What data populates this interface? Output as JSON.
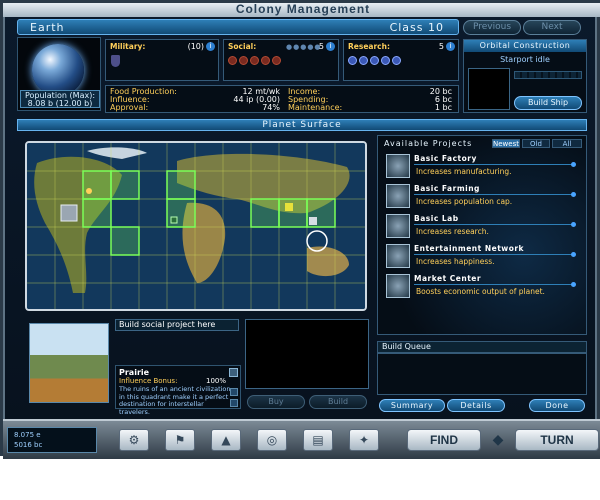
{
  "window": {
    "title": "Colony Management"
  },
  "planet": {
    "name": "Earth",
    "class": "Class 10",
    "population": "Population (Max):",
    "population_value": "8.08 b (12.00 b)",
    "prev_label": "Previous",
    "next_label": "Next"
  },
  "stats": {
    "military": {
      "label": "Military:",
      "value": "(10)"
    },
    "social": {
      "label": "Social:",
      "value": "5"
    },
    "research": {
      "label": "Research:",
      "value": "5"
    }
  },
  "economy": {
    "food_label": "Food Production:",
    "food_value": "12 mt/wk",
    "influence_label": "Influence:",
    "influence_value": "44 ip (0.00)",
    "approval_label": "Approval:",
    "approval_value": "74%",
    "income_label": "Income:",
    "income_value": "20 bc",
    "spending_label": "Spending:",
    "spending_value": "6 bc",
    "maintenance_label": "Maintenance:",
    "maintenance_value": "1 bc"
  },
  "orbital": {
    "title": "Orbital Construction",
    "status": "Starport idle",
    "build_ship_label": "Build Ship"
  },
  "surface": {
    "title": "Planet Surface",
    "build_label": "Build social project here",
    "tile_name": "Prairie",
    "bonus_label": "Influence Bonus:",
    "bonus_value": "100%",
    "description": "The ruins of an ancient civilization in this quadrant make it a perfect destination for interstellar travelers.",
    "buy_label": "Buy",
    "build_btn_label": "Build"
  },
  "projects": {
    "title": "Available Projects",
    "tabs": [
      "Newest",
      "Old",
      "All"
    ],
    "items": [
      {
        "name": "Basic Factory",
        "desc": "Increases manufacturing.",
        "icon": "factory-icon"
      },
      {
        "name": "Basic Farming",
        "desc": "Increases population cap.",
        "icon": "farm-icon"
      },
      {
        "name": "Basic Lab",
        "desc": "Increases research.",
        "icon": "lab-icon"
      },
      {
        "name": "Entertainment Network",
        "desc": "Increases happiness.",
        "icon": "entertainment-icon"
      },
      {
        "name": "Market Center",
        "desc": "Boosts economic output of planet.",
        "icon": "market-icon"
      }
    ]
  },
  "queue": {
    "title": "Build Queue",
    "summary_label": "Summary",
    "details_label": "Details",
    "done_label": "Done"
  },
  "toolbar": {
    "status_line1": "8.075 e",
    "status_line2": "5016 bc",
    "find_label": "FIND",
    "turn_label": "TURN"
  },
  "colors": {
    "accent": "#2e7fb7",
    "highlight_tiles": "#7bff57",
    "gold_text": "#ffcf5a"
  }
}
